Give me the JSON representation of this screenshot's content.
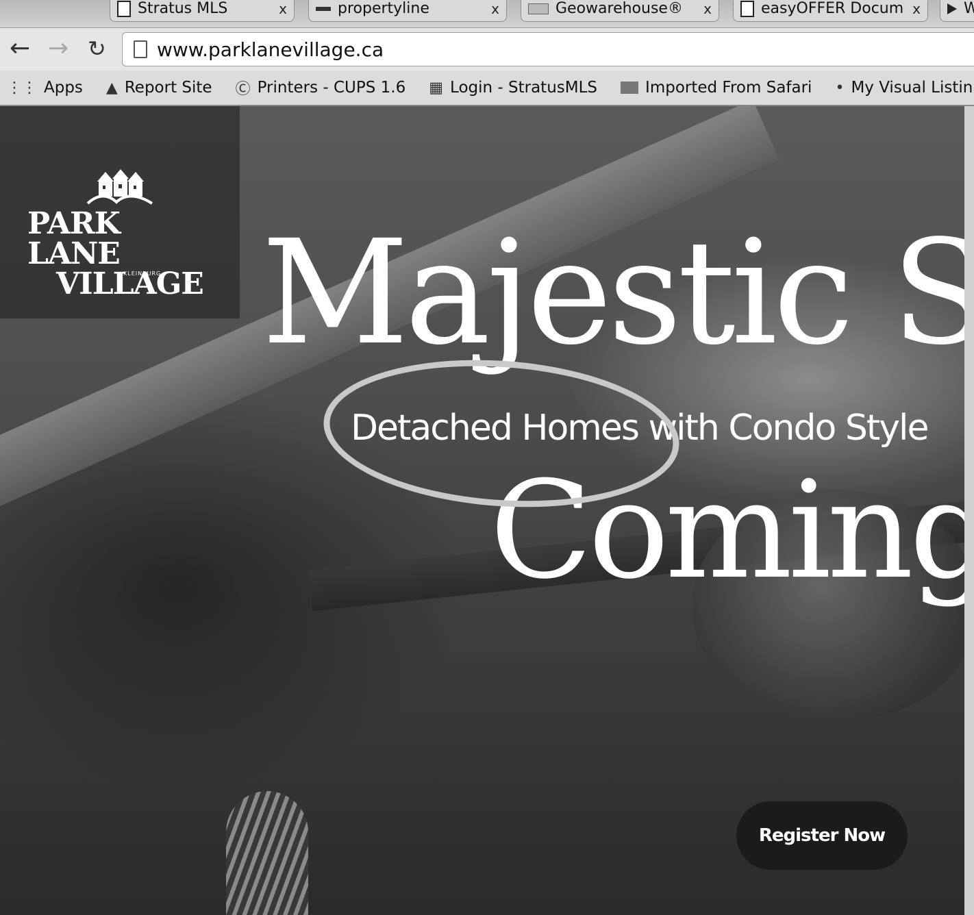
{
  "browser": {
    "tabs": [
      {
        "title": "Stratus MLS",
        "icon": "page-icon"
      },
      {
        "title": "propertyline",
        "icon": "propertyline-icon"
      },
      {
        "title": "Geowarehouse®",
        "icon": "geowarehouse-icon"
      },
      {
        "title": "easyOFFER Docum",
        "icon": "page-icon"
      },
      {
        "title": "W",
        "icon": "arrow-icon"
      }
    ],
    "tab_close_glyph": "x",
    "url": "www.parklanevillage.ca",
    "bookmarks": [
      {
        "label": "Apps",
        "icon": "apps-icon"
      },
      {
        "label": "Report Site",
        "icon": "report-icon"
      },
      {
        "label": "Printers - CUPS 1.6",
        "icon": "cups-icon"
      },
      {
        "label": "Login - StratusMLS",
        "icon": "stratus-icon"
      },
      {
        "label": "Imported From Safari",
        "icon": "folder-icon"
      },
      {
        "label": "My Visual Listin",
        "icon": "bookmark-icon"
      }
    ]
  },
  "page": {
    "logo": {
      "line1": "PARK LANE",
      "line2": "VILLAGE",
      "sub": "KLEINBURG"
    },
    "headline": "Majestic S",
    "subheadline": "Detached Homes with Condo Style",
    "headline2": "Coming S",
    "register_label": "Register Now"
  }
}
